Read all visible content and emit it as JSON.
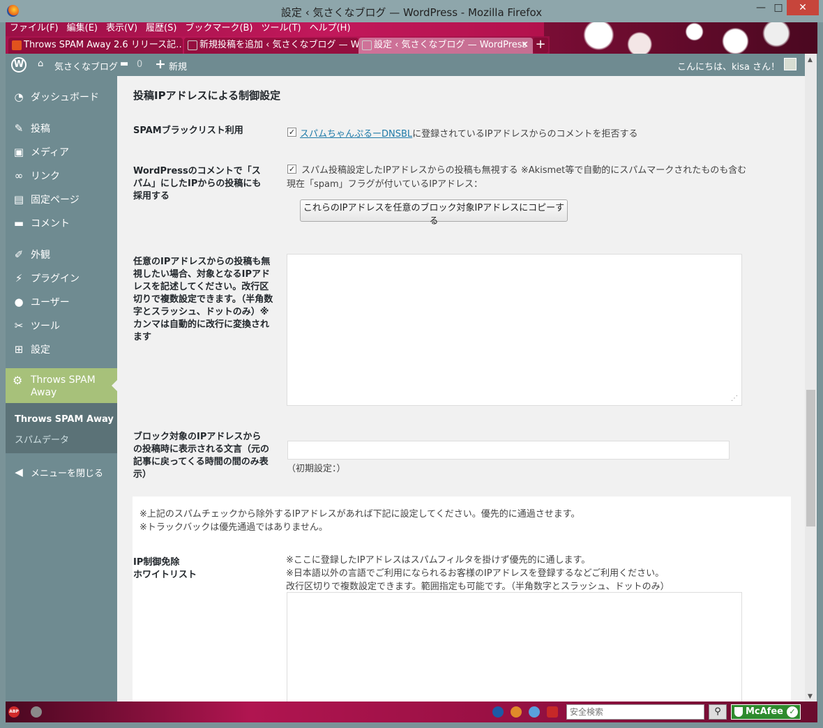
{
  "window": {
    "title": "設定 ‹ 気さくなブログ — WordPress - Mozilla Firefox",
    "min": "—",
    "max": "□",
    "close": "✕"
  },
  "menubar": [
    "ファイル(F)",
    "編集(E)",
    "表示(V)",
    "履歴(S)",
    "ブックマーク(B)",
    "ツール(T)",
    "ヘルプ(H)"
  ],
  "tabs": [
    {
      "label": "Throws SPAM Away 2.6 リリース記…"
    },
    {
      "label": "新規投稿を追加 ‹ 気さくなブログ — W…"
    },
    {
      "label": "設定 ‹ 気さくなブログ — WordPress",
      "close": "✕"
    }
  ],
  "newtab": "+",
  "adminbar": {
    "site": "気さくなブログ",
    "comments": "0",
    "new": "新規",
    "greeting": "こんにちは、kisa さん！"
  },
  "sidebar": {
    "items": [
      {
        "label": "ダッシュボード",
        "icon": "◔"
      },
      {
        "label": "投稿",
        "icon": "✎"
      },
      {
        "label": "メディア",
        "icon": "▣"
      },
      {
        "label": "リンク",
        "icon": "∞"
      },
      {
        "label": "固定ページ",
        "icon": "▤"
      },
      {
        "label": "コメント",
        "icon": "▬"
      },
      {
        "label": "外観",
        "icon": "✐"
      },
      {
        "label": "プラグイン",
        "icon": "⚡"
      },
      {
        "label": "ユーザー",
        "icon": "●"
      },
      {
        "label": "ツール",
        "icon": "✂"
      },
      {
        "label": "設定",
        "icon": "⊞"
      }
    ],
    "active": {
      "label": "Throws SPAM Away",
      "icon": "⚙"
    },
    "sub_current": "Throws SPAM Away",
    "sub_other": "スパムデータ",
    "collapse": {
      "label": "メニューを閉じる",
      "icon": "◀"
    }
  },
  "content": {
    "heading": "投稿IPアドレスによる制御設定",
    "row1": {
      "label": "SPAMブラックリスト利用",
      "link": "スパムちゃんぷるーDNSBL",
      "text": "に登録されているIPアドレスからのコメントを拒否する",
      "checked": "✓"
    },
    "row2": {
      "label": "WordPressのコメントで「スパム」にしたIPからの投稿にも採用する",
      "text": "スパム投稿設定したIPアドレスからの投稿も無視する ※Akismet等で自動的にスパムマークされたものも含む",
      "text2": "現在「spam」フラグが付いているIPアドレス：",
      "button": "これらのIPアドレスを任意のブロック対象IPアドレスにコピーする",
      "checked": "✓"
    },
    "row3": {
      "label": "任意のIPアドレスからの投稿も無視したい場合、対象となるIPアドレスを記述してください。改行区切りで複数設定できます。（半角数字とスラッシュ、ドットのみ）※カンマは自動的に改行に変換されます"
    },
    "row4": {
      "label": "ブロック対象のIPアドレスからの投稿時に表示される文言（元の記事に戻ってくる時間の間のみ表示）",
      "hint": "（初期設定：）"
    },
    "note1": "※上記のスパムチェックから除外するIPアドレスがあれば下記に設定してください。優先的に通過させます。",
    "note2": "※トラックバックは優先通過ではありません。",
    "row5": {
      "label1": "IP制御免除",
      "label2": "ホワイトリスト",
      "d1": "※ここに登録したIPアドレスはスパムフィルタを掛けず優先的に通します。",
      "d2": "※日本語以外の言語でご利用になられるお客様のIPアドレスを登録するなどご利用ください。",
      "d3": "改行区切りで複数設定できます。範囲指定も可能です。（半角数字とスラッシュ、ドットのみ）"
    }
  },
  "statusbar": {
    "search_placeholder": "安全検索",
    "mcafee": "McAfee"
  }
}
